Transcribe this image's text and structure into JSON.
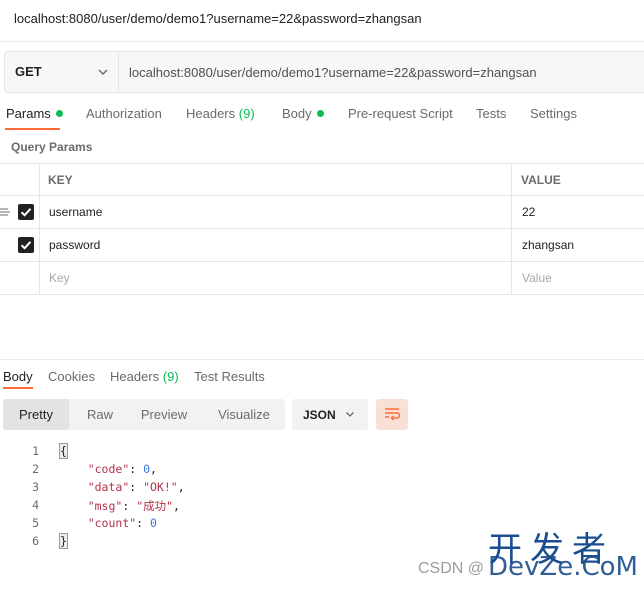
{
  "window": {
    "title": "localhost:8080/user/demo/demo1?username=22&password=zhangsan"
  },
  "request": {
    "method": "GET",
    "url": "localhost:8080/user/demo/demo1?username=22&password=zhangsan"
  },
  "request_tabs": {
    "params": "Params",
    "authorization": "Authorization",
    "headers": "Headers",
    "headers_count": "(9)",
    "body": "Body",
    "prerequest": "Pre-request Script",
    "tests": "Tests",
    "settings": "Settings"
  },
  "query_params": {
    "section_title": "Query Params",
    "columns": {
      "key": "KEY",
      "value": "VALUE"
    },
    "rows": [
      {
        "key": "username",
        "value": "22",
        "checked": true
      },
      {
        "key": "password",
        "value": "zhangsan",
        "checked": true
      }
    ],
    "new_row": {
      "key_placeholder": "Key",
      "value_placeholder": "Value"
    }
  },
  "response_tabs": {
    "body": "Body",
    "cookies": "Cookies",
    "headers": "Headers",
    "headers_count": "(9)",
    "test_results": "Test Results"
  },
  "response_toolbar": {
    "pretty": "Pretty",
    "raw": "Raw",
    "preview": "Preview",
    "visualize": "Visualize",
    "format": "JSON"
  },
  "response_body": {
    "line_numbers": [
      "1",
      "2",
      "3",
      "4",
      "5",
      "6"
    ],
    "open_brace": "{",
    "close_brace": "}",
    "fields": [
      {
        "key": "\"code\"",
        "value": "0",
        "type": "number",
        "comma": ","
      },
      {
        "key": "\"data\"",
        "value": "\"OK!\"",
        "type": "string",
        "comma": ","
      },
      {
        "key": "\"msg\"",
        "value": "\"成功\"",
        "type": "string",
        "comma": ","
      },
      {
        "key": "\"count\"",
        "value": "0",
        "type": "number",
        "comma": ""
      }
    ]
  },
  "watermark": {
    "cn": "开发者",
    "csdn": "CSDN @",
    "en": "DevZe.CoM"
  },
  "colors": {
    "accent": "#ff6c37",
    "green": "#0cbb52",
    "string": "#b4324a",
    "number": "#3875d6"
  }
}
